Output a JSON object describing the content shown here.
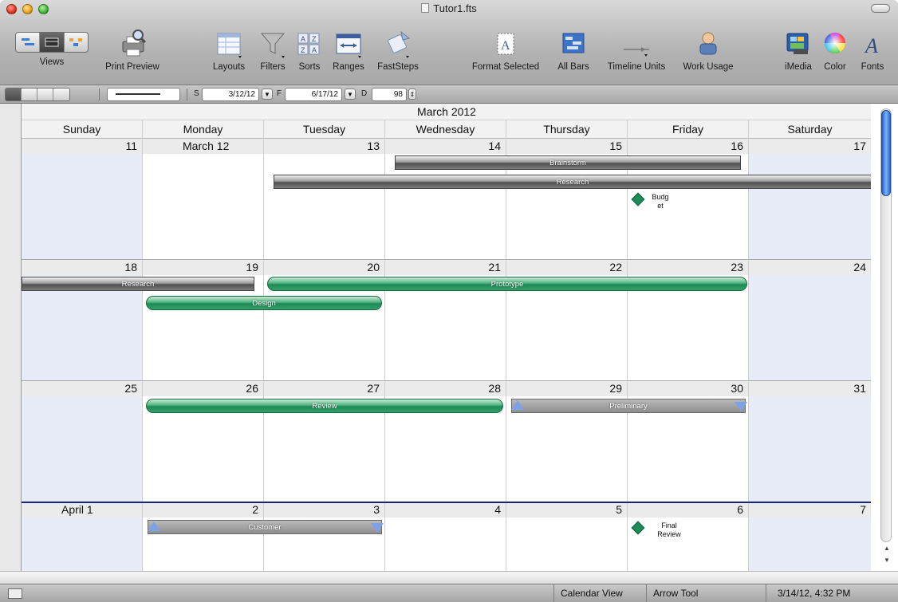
{
  "window": {
    "title": "Tutor1.fts"
  },
  "toolbar": {
    "views_label": "Views",
    "print_preview_label": "Print Preview",
    "layouts_label": "Layouts",
    "filters_label": "Filters",
    "sorts_label": "Sorts",
    "ranges_label": "Ranges",
    "faststeps_label": "FastSteps",
    "format_selected_label": "Format Selected",
    "all_bars_label": "All Bars",
    "timeline_units_label": "Timeline Units",
    "work_usage_label": "Work Usage",
    "imedia_label": "iMedia",
    "color_label": "Color",
    "fonts_label": "Fonts"
  },
  "subbar": {
    "start_label": "S",
    "start_value": "3/12/12",
    "finish_label": "F",
    "finish_value": "6/17/12",
    "duration_label": "D",
    "duration_value": "98"
  },
  "calendar": {
    "month_title": "March 2012",
    "weekdays": [
      "Sunday",
      "Monday",
      "Tuesday",
      "Wednesday",
      "Thursday",
      "Friday",
      "Saturday"
    ],
    "weeks": [
      [
        "11",
        "March 12",
        "13",
        "14",
        "15",
        "16",
        "17"
      ],
      [
        "18",
        "19",
        "20",
        "21",
        "22",
        "23",
        "24"
      ],
      [
        "25",
        "26",
        "27",
        "28",
        "29",
        "30",
        "31"
      ],
      [
        "April 1",
        "2",
        "3",
        "4",
        "5",
        "6",
        "7"
      ]
    ],
    "tasks": {
      "brainstorm": "Brainstorm",
      "research_week1": "Research",
      "research_week2": "Research",
      "prototype": "Prototype",
      "design": "Design",
      "review": "Review",
      "preliminary": "Preliminary",
      "customer": "Customer",
      "budget_line1": "Budg",
      "budget_line2": "et",
      "final_review_line1": "Final",
      "final_review_line2": "Review"
    }
  },
  "status": {
    "view": "Calendar View",
    "tool": "Arrow Tool",
    "datetime": "3/14/12, 4:32 PM"
  },
  "colors": {
    "task_bar_green": "#1e8a56",
    "milestone_green": "#1d8a5a",
    "weekend_blue": "#e7ecf8",
    "week_separator": "#1a237e",
    "scroll_thumb": "#2a6fd6"
  }
}
